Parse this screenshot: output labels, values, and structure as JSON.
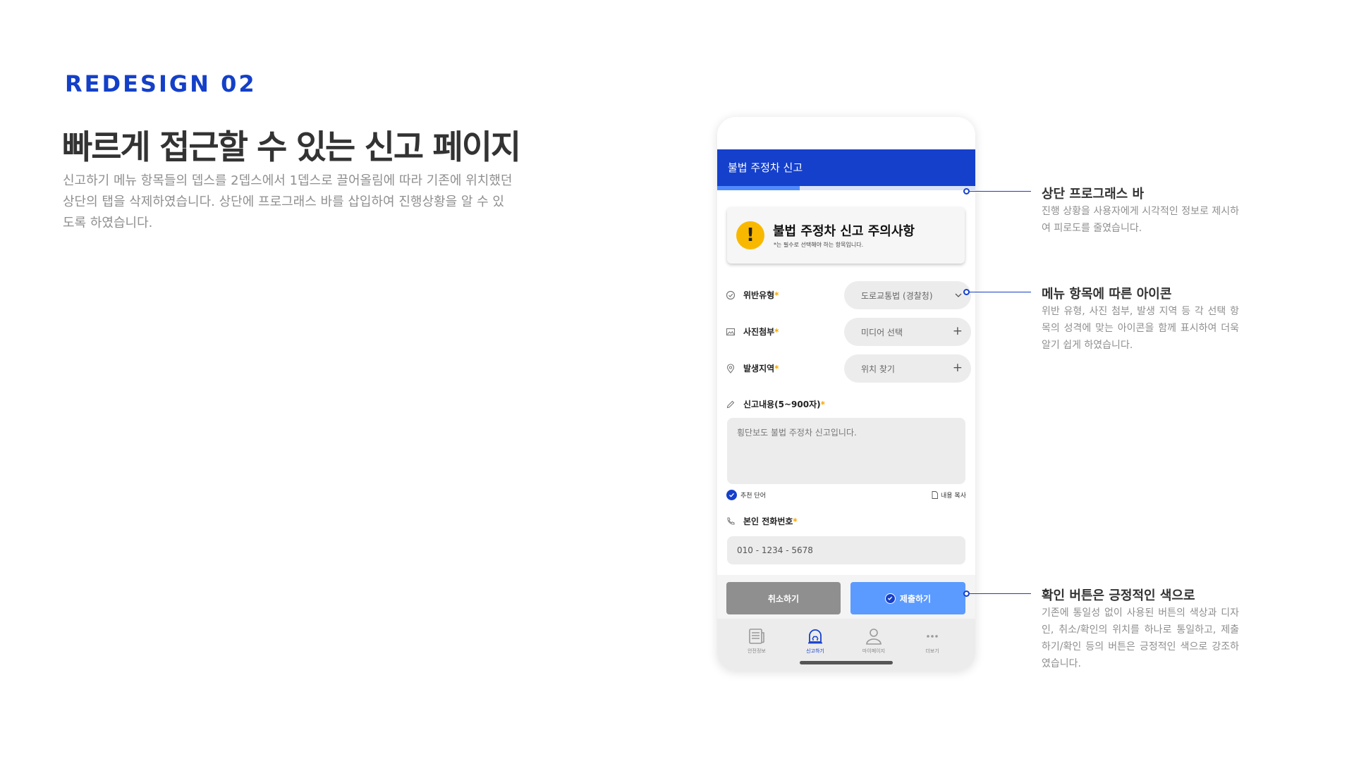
{
  "intro": {
    "tag": "REDESIGN 02",
    "headline": "빠르게 접근할 수 있는 신고 페이지",
    "description": "신고하기 메뉴 항목들의 뎁스를 2뎁스에서 1뎁스로 끌어올림에 따라 기존에 위치했던 상단의 탭을 삭제하였습니다. 상단에 프로그래스 바를 삽입하여 진행상황을 알 수 있도록 하였습니다."
  },
  "phone": {
    "appbar_title": "불법 주정차 신고",
    "progress": 0.32,
    "notice": {
      "icon": "!",
      "title": "불법 주정차 신고 주의사항",
      "subtitle": "*는 필수로 선택해야 하는 항목입니다."
    },
    "fields": {
      "violation": {
        "label": "위반유형",
        "required_mark": "*",
        "value": "도로교통법 (경찰청)",
        "icon": "check-circle-icon",
        "end_icon": "chevron-down-icon"
      },
      "photo": {
        "label": "사진첨부",
        "required_mark": "*",
        "value": "미디어 선택",
        "icon": "image-icon",
        "end_icon": "plus-icon",
        "end_glyph": "+"
      },
      "location": {
        "label": "발생지역",
        "required_mark": "*",
        "value": "위치 찾기",
        "icon": "location-pin-icon",
        "end_icon": "plus-icon",
        "end_glyph": "+"
      }
    },
    "content": {
      "label": "신고내용(5~900자)",
      "required_mark": "*",
      "text": "횡단보도 불법 주정차 신고입니다.",
      "recommend_label": "추천 단어",
      "copy_label": "내용 복사"
    },
    "phone_number": {
      "label": "본인 전화번호",
      "required_mark": "*",
      "value": "010 - 1234 - 5678"
    },
    "buttons": {
      "cancel": "취소하기",
      "submit": "제출하기"
    },
    "tabs": [
      {
        "label": "안전정보",
        "icon": "newspaper-icon",
        "active": false
      },
      {
        "label": "신고하기",
        "icon": "siren-icon",
        "active": true
      },
      {
        "label": "마이페이지",
        "icon": "person-icon",
        "active": false
      },
      {
        "label": "더보기",
        "icon": "more-icon",
        "active": false
      }
    ]
  },
  "callouts": [
    {
      "title": "상단 프로그래스 바",
      "text": "진행 상황을 사용자에게 시각적인 정보로 제시하여 피로도를 줄였습니다."
    },
    {
      "title": "메뉴 항목에 따른 아이콘",
      "text": "위반 유형, 사진 첨부, 발생 지역 등 각 선택 항목의 성격에 맞는 아이콘을 함께 표시하여 더욱 알기 쉽게 하였습니다."
    },
    {
      "title": "확인 버튼은 긍정적인 색으로",
      "text": "기존에 통일성 없이 사용된 버튼의 색상과 디자인, 취소/확인의 위치를 하나로 통일하고, 제출하기/확인 등의 버튼은 긍정적인 색으로 강조하였습니다."
    }
  ],
  "colors": {
    "accent": "#1540cc",
    "submit": "#5b9bff",
    "cancel": "#8f8f8f",
    "warning": "#f9b800",
    "required": "#f7a600"
  }
}
